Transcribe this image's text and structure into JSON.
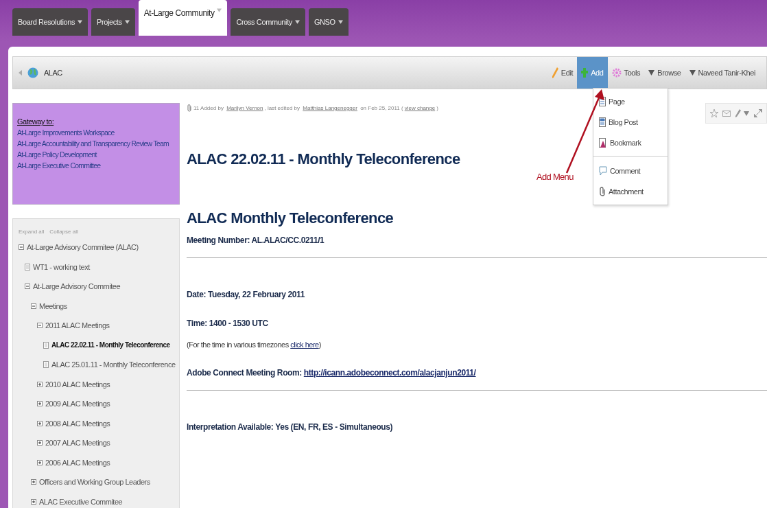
{
  "tabs": [
    {
      "label": "Board Resolutions",
      "selected": false
    },
    {
      "label": "Projects",
      "selected": false
    },
    {
      "label": "At-Large Community",
      "selected": true
    },
    {
      "label": "Cross Community",
      "selected": false
    },
    {
      "label": "GNSO",
      "selected": false
    }
  ],
  "breadcrumb": {
    "label": "ALAC"
  },
  "toolbar": [
    {
      "label": "Edit",
      "kind": "edit",
      "selected": false
    },
    {
      "label": "Add",
      "kind": "add",
      "selected": true
    },
    {
      "label": "Tools",
      "kind": "tools",
      "selected": false
    },
    {
      "label": "Browse",
      "kind": "dropdown",
      "selected": false
    },
    {
      "label": "Naveed Tanir-Khei",
      "kind": "dropdown",
      "selected": false
    }
  ],
  "add_menu": [
    [
      {
        "label": "Page",
        "kind": "page"
      },
      {
        "label": "Blog Post",
        "kind": "blog"
      },
      {
        "label": "Bookmark",
        "kind": "bookmark"
      }
    ],
    [
      {
        "label": "Comment",
        "kind": "comment"
      },
      {
        "label": "Attachment",
        "kind": "attachment"
      }
    ]
  ],
  "annotation": {
    "label": "Add Menu"
  },
  "gateway": {
    "title": "Gateway to:",
    "links": [
      "At-Large Improvements Workspace",
      "At-Large Accountability and Transparency Review Team",
      "At-Large Policy Development",
      "At-Large Executive Committee"
    ]
  },
  "sidebar": {
    "expand_all": "Expand all",
    "collapse_all": "Collapse all",
    "tree": [
      {
        "label": "At-Large Advisory Commitee (ALAC)",
        "kind": "folder",
        "expanded": true,
        "selected": false,
        "children": [
          {
            "label": "WT1 - working text",
            "kind": "page",
            "selected": false
          },
          {
            "label": "At-Large Advisory Commitee",
            "kind": "folder",
            "expanded": true,
            "selected": false,
            "children": [
              {
                "label": "Meetings",
                "kind": "folder",
                "expanded": true,
                "selected": false,
                "children": [
                  {
                    "label": "2011 ALAC Meetings",
                    "kind": "folder",
                    "expanded": true,
                    "selected": false,
                    "children": [
                      {
                        "label": "ALAC 22.02.11 - Monthly Teleconference",
                        "kind": "page",
                        "selected": true
                      },
                      {
                        "label": "ALAC 25.01.11 - Monthly Teleconference",
                        "kind": "page",
                        "selected": false
                      }
                    ]
                  },
                  {
                    "label": "2010 ALAC Meetings",
                    "kind": "folder",
                    "expanded": false,
                    "selected": false
                  },
                  {
                    "label": "2009 ALAC Meetings",
                    "kind": "folder",
                    "expanded": false,
                    "selected": false
                  },
                  {
                    "label": "2008 ALAC Meetings",
                    "kind": "folder",
                    "expanded": false,
                    "selected": false
                  },
                  {
                    "label": "2007 ALAC Meetings",
                    "kind": "folder",
                    "expanded": false,
                    "selected": false
                  },
                  {
                    "label": "2006 ALAC Meetings",
                    "kind": "folder",
                    "expanded": false,
                    "selected": false
                  }
                ]
              },
              {
                "label": "Officers and Working Group Leaders",
                "kind": "folder",
                "expanded": false,
                "selected": false
              },
              {
                "label": "ALAC Executive Commitee",
                "kind": "folder",
                "expanded": false,
                "selected": false
              }
            ]
          }
        ]
      }
    ]
  },
  "page": {
    "meta": {
      "version": "11",
      "added": "Added by",
      "author": "Marilyn Vernon",
      "edited": ", last edited by",
      "editor": "Matthias Langenegger",
      "date": "on Feb 25, 2011 (",
      "change": "view change",
      "close": ")"
    },
    "title": "ALAC 22.02.11 - Monthly Teleconference",
    "content": [
      {
        "kind": "heading",
        "text": "ALAC Monthly Teleconference"
      },
      {
        "kind": "label",
        "text": "Meeting Number: AL.ALAC/CC.0211/1"
      },
      {
        "kind": "rule"
      },
      {
        "kind": "label",
        "text": "Date: Tuesday, 22 February 2011"
      },
      {
        "kind": "label",
        "text": "Time: 1400 - 1530 UTC"
      },
      {
        "kind": "note",
        "text": "(For the time in various timezones ",
        "link": "click here",
        "after": ")"
      },
      {
        "kind": "label",
        "text": "Adobe Connect Meeting Room: ",
        "link": "http://icann.adobeconnect.com/alacjanjun2011/"
      },
      {
        "kind": "rule"
      },
      {
        "kind": "label",
        "text": "Interpretation Available: Yes (EN, FR, ES - Simultaneous)"
      }
    ]
  }
}
